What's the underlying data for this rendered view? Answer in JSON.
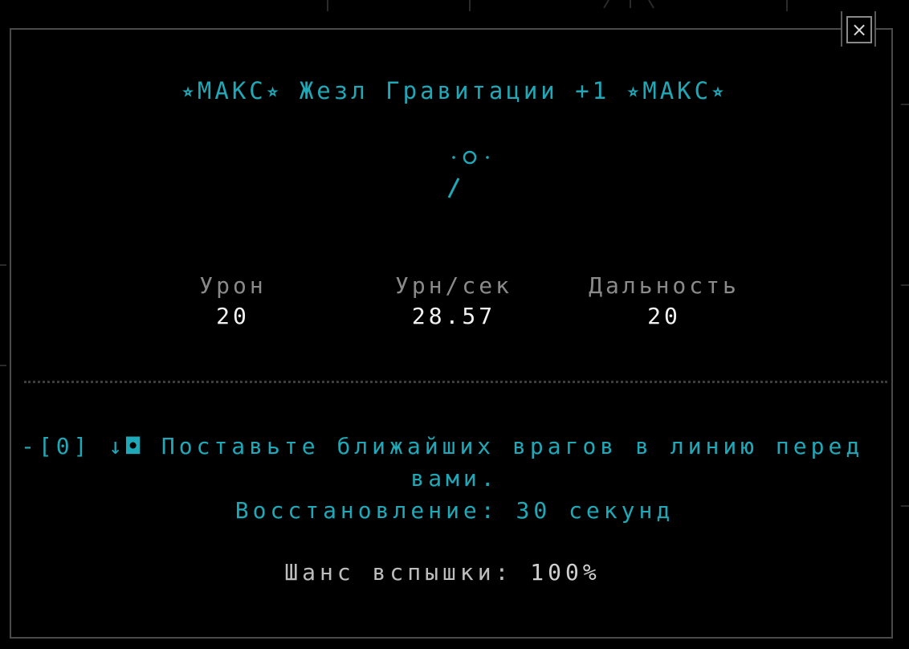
{
  "window": {
    "close_label": "×"
  },
  "item": {
    "title": "⭒МАКС⭒ Жезл Гравитации +1 ⭒МАКС⭒",
    "icon": "wand-icon",
    "color": "#1fa9b8"
  },
  "stats": {
    "damage": {
      "label": "Урон",
      "value": "20"
    },
    "dps": {
      "label": "Урн/сек",
      "value": "28.57"
    },
    "range": {
      "label": "Дальность",
      "value": "20"
    }
  },
  "ability": {
    "key": "-[0]",
    "icon": "↓◘",
    "description_line1": "Поставьте ближайших врагов в линию перед",
    "description_line2": "вами.",
    "cooldown": "Восстановление: 30 секунд"
  },
  "crit": {
    "label": "Шанс вспышки:",
    "value": "100%"
  },
  "colors": {
    "accent": "#1fa9b8",
    "label_gray": "#8a8a8a",
    "value_white": "#f2f2f2",
    "border": "#4a4a4a"
  }
}
